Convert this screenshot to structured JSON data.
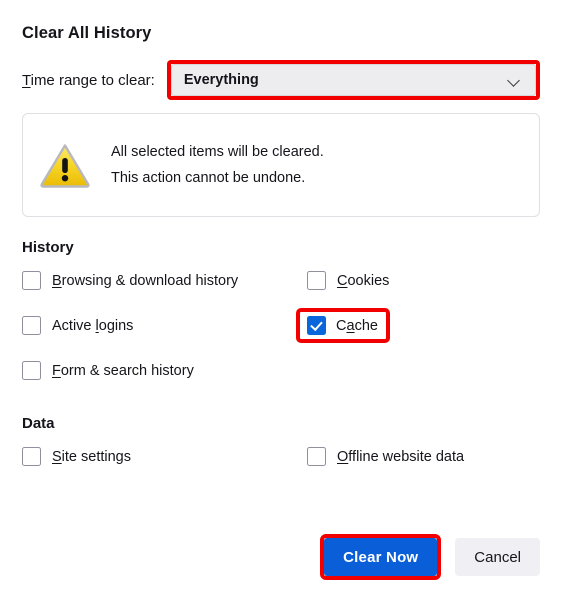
{
  "dialog": {
    "title": "Clear All History",
    "time_range": {
      "label_prefix": "T",
      "label_rest": "ime range to clear:",
      "selected_value": "Everything",
      "chevron_icon": "chevron-down-icon"
    },
    "warning": {
      "icon": "warning-triangle-icon",
      "line1": "All selected items will be cleared.",
      "line2": "This action cannot be undone."
    },
    "sections": [
      {
        "heading": "History",
        "items": [
          {
            "ak": "B",
            "rest": "rowsing & download history",
            "checked": false,
            "highlighted": false,
            "column": "left"
          },
          {
            "ak": "C",
            "rest": "ookies",
            "checked": false,
            "highlighted": false,
            "column": "right"
          },
          {
            "pre": "Active ",
            "ak": "l",
            "rest": "ogins",
            "checked": false,
            "highlighted": false,
            "column": "left"
          },
          {
            "pre": "C",
            "ak": "a",
            "rest": "che",
            "checked": true,
            "highlighted": true,
            "column": "right"
          },
          {
            "ak": "F",
            "rest": "orm & search history",
            "checked": false,
            "highlighted": false,
            "column": "left"
          }
        ]
      },
      {
        "heading": "Data",
        "items": [
          {
            "ak": "S",
            "rest": "ite settings",
            "checked": false,
            "highlighted": false,
            "column": "left"
          },
          {
            "ak": "O",
            "rest": "ffline website data",
            "checked": false,
            "highlighted": false,
            "column": "right"
          }
        ]
      }
    ],
    "footer": {
      "primary_label": "Clear Now",
      "secondary_label": "Cancel"
    }
  },
  "colors": {
    "highlight_red": "#f20000",
    "primary_blue": "#0a5ed7",
    "checkbox_blue": "#0a66da",
    "warning_yellow": "#f7d117"
  }
}
